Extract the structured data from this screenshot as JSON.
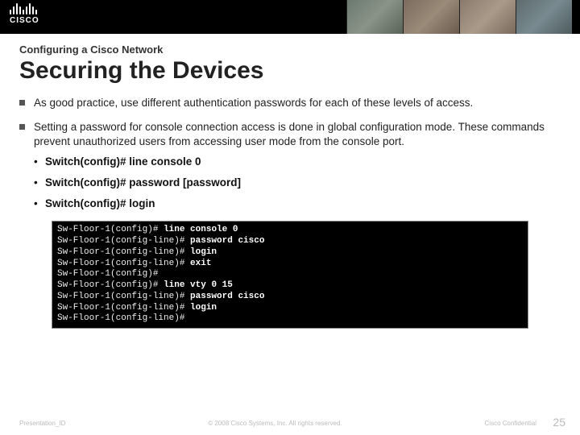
{
  "header": {
    "logo_text": "CISCO"
  },
  "eyebrow": "Configuring a Cisco Network",
  "title": "Securing the Devices",
  "bullets": [
    {
      "text": "As good practice, use different authentication passwords for each of these levels of access."
    },
    {
      "text": "Setting a password for console connection access is done in global configuration mode. These commands prevent unauthorized users from accessing user mode from the console port.",
      "sub": [
        "Switch(config)# line console 0",
        "Switch(config)# password [password]",
        "Switch(config)# login"
      ]
    }
  ],
  "terminal_lines": [
    {
      "prompt": "Sw-Floor-1(config)#",
      "cmd": "line console 0"
    },
    {
      "prompt": "Sw-Floor-1(config-line)#",
      "cmd": "password cisco"
    },
    {
      "prompt": "Sw-Floor-1(config-line)#",
      "cmd": "login"
    },
    {
      "prompt": "Sw-Floor-1(config-line)#",
      "cmd": "exit"
    },
    {
      "prompt": "Sw-Floor-1(config)#",
      "cmd": ""
    },
    {
      "prompt": "Sw-Floor-1(config)#",
      "cmd": "line vty 0 15"
    },
    {
      "prompt": "Sw-Floor-1(config-line)#",
      "cmd": "password cisco"
    },
    {
      "prompt": "Sw-Floor-1(config-line)#",
      "cmd": "login"
    },
    {
      "prompt": "Sw-Floor-1(config-line)#",
      "cmd": ""
    }
  ],
  "footer": {
    "id": "Presentation_ID",
    "copyright": "© 2008 Cisco Systems, Inc. All rights reserved.",
    "confidential": "Cisco Confidential",
    "page": "25"
  }
}
